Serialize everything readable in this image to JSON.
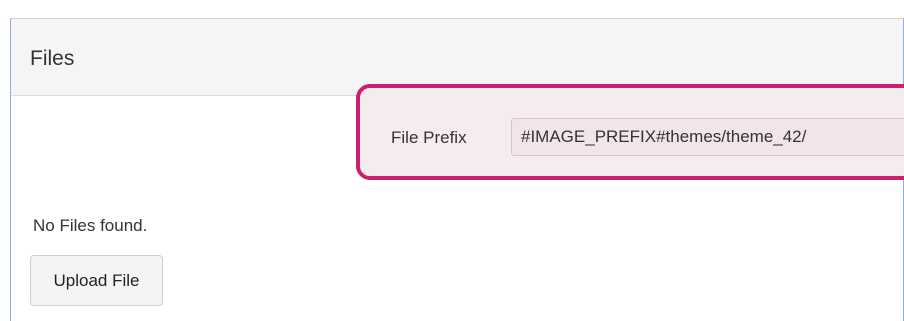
{
  "panel": {
    "title": "Files"
  },
  "file_prefix": {
    "label": "File Prefix",
    "value": "#IMAGE_PREFIX#themes/theme_42/"
  },
  "content": {
    "empty_message": "No Files found."
  },
  "actions": {
    "upload_label": "Upload File"
  },
  "colors": {
    "highlight_border": "#c9216f",
    "highlight_fill": "#f6ebee"
  }
}
